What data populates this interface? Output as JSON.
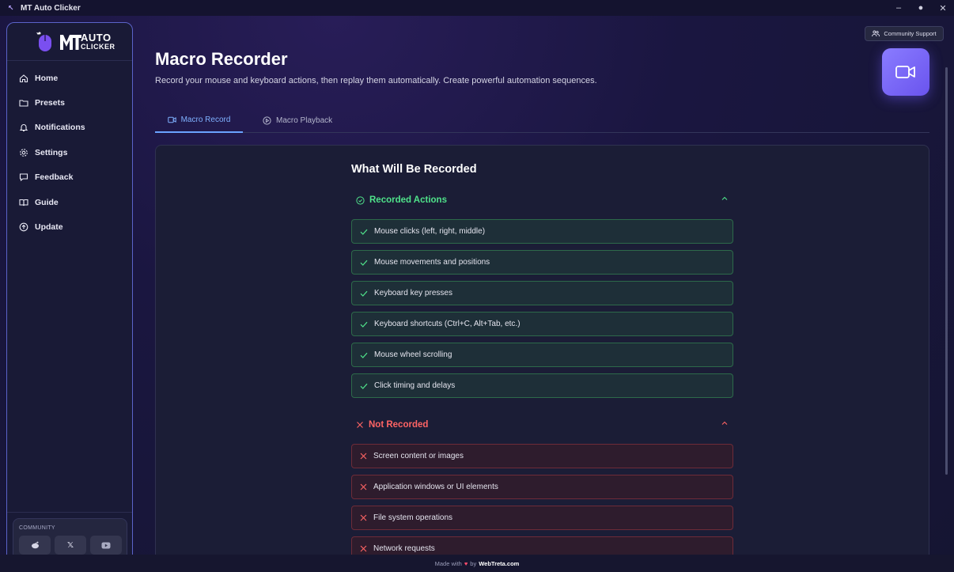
{
  "window": {
    "title": "MT Auto Clicker"
  },
  "logo": {
    "line1": "AUTO",
    "line2": "CLICKER"
  },
  "sidebar": {
    "items": [
      {
        "label": "Home",
        "icon": "home-icon"
      },
      {
        "label": "Presets",
        "icon": "folder-icon"
      },
      {
        "label": "Notifications",
        "icon": "bell-icon"
      },
      {
        "label": "Settings",
        "icon": "gear-icon"
      },
      {
        "label": "Feedback",
        "icon": "message-icon"
      },
      {
        "label": "Guide",
        "icon": "book-icon"
      },
      {
        "label": "Update",
        "icon": "arrow-up-circle-icon"
      }
    ],
    "community": {
      "title": "COMMUNITY",
      "buttons": [
        {
          "icon": "reddit-icon"
        },
        {
          "icon": "x-icon",
          "glyph": "𝕏"
        },
        {
          "icon": "youtube-icon"
        }
      ]
    }
  },
  "header": {
    "support_label": "Community Support",
    "title": "Macro Recorder",
    "subtitle": "Record your mouse and keyboard actions, then replay them automatically. Create powerful automation sequences."
  },
  "tabs": [
    {
      "label": "Macro Record",
      "active": true
    },
    {
      "label": "Macro Playback",
      "active": false
    }
  ],
  "content": {
    "title": "What Will Be Recorded",
    "recorded": {
      "heading": "Recorded Actions",
      "items": [
        "Mouse clicks (left, right, middle)",
        "Mouse movements and positions",
        "Keyboard key presses",
        "Keyboard shortcuts (Ctrl+C, Alt+Tab, etc.)",
        "Mouse wheel scrolling",
        "Click timing and delays"
      ]
    },
    "not_recorded": {
      "heading": "Not Recorded",
      "items": [
        "Screen content or images",
        "Application windows or UI elements",
        "File system operations",
        "Network requests"
      ]
    }
  },
  "footer": {
    "made_with": "Made with",
    "by": "by",
    "brand": "WebTreta.com"
  },
  "colors": {
    "accent": "#6aa3ff",
    "success": "#4fe28a",
    "danger": "#ff6464",
    "brand": "#7b68ff"
  }
}
